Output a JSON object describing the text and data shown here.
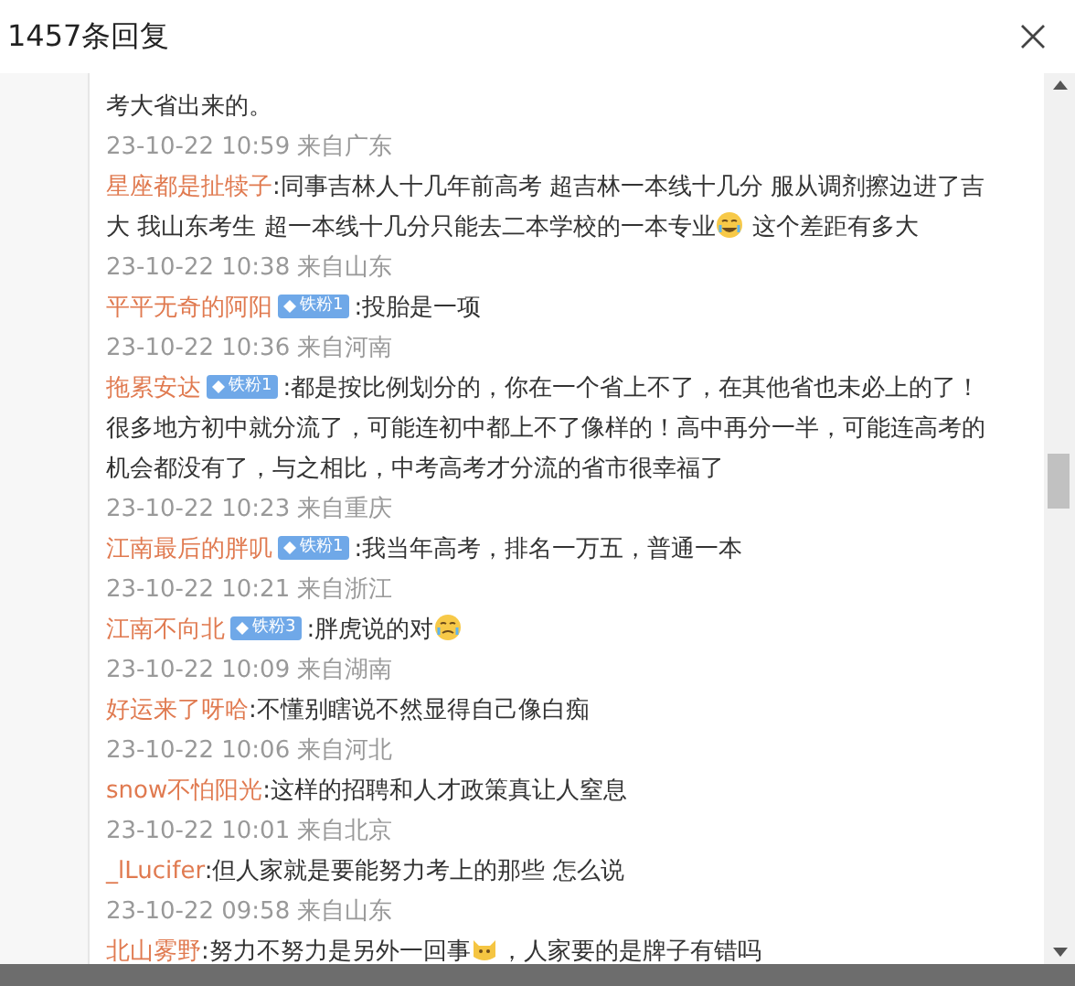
{
  "dialog": {
    "title": "1457条回复"
  },
  "replies": [
    {
      "parts": [
        {
          "kind": "text",
          "text": "考大省出来的。"
        }
      ],
      "time": "23-10-22 10:59 来自广东"
    },
    {
      "user": "星座都是扯犊子",
      "parts": [
        {
          "kind": "text",
          "text": ":同事吉林人十几年前高考 超吉林一本线十几分 服从调剂擦边进了吉大 我山东考生 超一本线十几分只能去二本学校的一本专业"
        },
        {
          "kind": "laugh"
        },
        {
          "kind": "text",
          "text": " 这个差距有多大"
        }
      ],
      "time": "23-10-22 10:38 来自山东"
    },
    {
      "user": "平平无奇的阿阳",
      "badge": "铁粉1",
      "parts": [
        {
          "kind": "text",
          "text": ":投胎是一项"
        }
      ],
      "time": "23-10-22 10:36 来自河南"
    },
    {
      "user": "拖累安达",
      "badge": "铁粉1",
      "parts": [
        {
          "kind": "text",
          "text": ":都是按比例划分的，你在一个省上不了，在其他省也未必上的了！很多地方初中就分流了，可能连初中都上不了像样的！高中再分一半，可能连高考的机会都没有了，与之相比，中考高考才分流的省市很幸福了"
        }
      ],
      "time": "23-10-22 10:23 来自重庆"
    },
    {
      "user": "江南最后的胖叽",
      "badge": "铁粉1",
      "parts": [
        {
          "kind": "text",
          "text": ":我当年高考，排名一万五，普通一本"
        }
      ],
      "time": "23-10-22 10:21 来自浙江"
    },
    {
      "user": "江南不向北",
      "badge": "铁粉3",
      "parts": [
        {
          "kind": "text",
          "text": ":胖虎说的对"
        },
        {
          "kind": "cry"
        }
      ],
      "time": "23-10-22 10:09 来自湖南"
    },
    {
      "user": "好运来了呀哈",
      "parts": [
        {
          "kind": "text",
          "text": ":不懂别瞎说不然显得自己像白痴"
        }
      ],
      "time": "23-10-22 10:06 来自河北"
    },
    {
      "user": "snow不怕阳光",
      "parts": [
        {
          "kind": "text",
          "text": ":这样的招聘和人才政策真让人窒息"
        }
      ],
      "time": "23-10-22 10:01 来自北京"
    },
    {
      "user": "_lLucifer",
      "parts": [
        {
          "kind": "text",
          "text": ":但人家就是要能努力考上的那些 怎么说"
        }
      ],
      "time": "23-10-22 09:58 来自山东"
    },
    {
      "user": "北山雾野",
      "parts": [
        {
          "kind": "text",
          "text": ":努力不努力是另外一回事"
        },
        {
          "kind": "cat"
        },
        {
          "kind": "text",
          "text": "，人家要的是牌子有错吗"
        }
      ]
    }
  ]
}
